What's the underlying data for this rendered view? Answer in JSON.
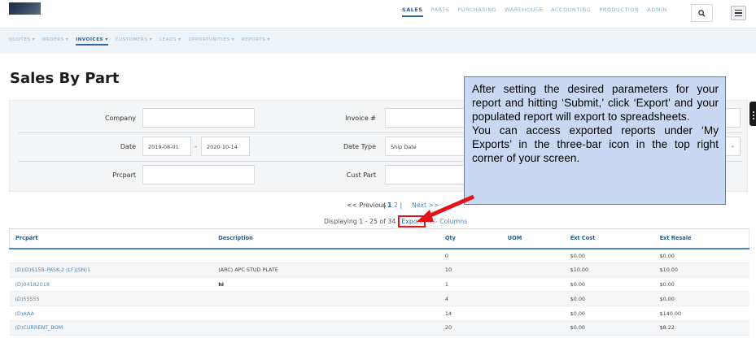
{
  "nav": {
    "main": [
      {
        "label": "SALES",
        "active": true
      },
      {
        "label": "PARTS",
        "active": false
      },
      {
        "label": "PURCHASING",
        "active": false
      },
      {
        "label": "WAREHOUSE",
        "active": false
      },
      {
        "label": "ACCOUNTING",
        "active": false
      },
      {
        "label": "PRODUCTION",
        "active": false
      },
      {
        "label": "ADMIN",
        "active": false
      }
    ],
    "sub": [
      {
        "label": "QUOTES ▾",
        "active": false
      },
      {
        "label": "ORDERS ▾",
        "active": false
      },
      {
        "label": "INVOICES ▾",
        "active": true
      },
      {
        "label": "CUSTOMERS ▾",
        "active": false
      },
      {
        "label": "LEADS ▾",
        "active": false
      },
      {
        "label": "OPPORTUNITIES ▾",
        "active": false
      },
      {
        "label": "REPORTS ▾",
        "active": false
      }
    ]
  },
  "page": {
    "title": "Sales By Part"
  },
  "filters": {
    "company_label": "Company",
    "invoice_label": "Invoice #",
    "date_label": "Date",
    "date_from": "2019-08-01",
    "date_sep": "-",
    "date_to": "2020-10-14",
    "date_type_label": "Date Type",
    "date_type_value": "Ship Date",
    "prcpart_label": "Prcpart",
    "cust_part_label": "Cust Part"
  },
  "callout": {
    "para1": "After setting the desired parameters for your report and hitting ‘Submit,’ click ‘Export’ and your populated report will export to spreadsheets.",
    "para2": "You can access exported reports under ‘My Exports’ in the three-bar icon in the top right corner of your screen."
  },
  "pagination": {
    "prev": "<< Previous",
    "sep": "|",
    "page1": "1",
    "page2": "2",
    "sep2": "|",
    "next": "Next >>",
    "displaying": "Displaying 1 - 25 of 34",
    "export": "Export",
    "columns": "+/- Columns"
  },
  "table": {
    "headers": [
      "Prcpart",
      "Description",
      "Qty",
      "UOM",
      "Ext Cost",
      "Ext Resale"
    ],
    "rows": [
      {
        "prcpart": "",
        "description": "",
        "qty": "0",
        "uom": "",
        "ext_cost": "$0.00",
        "ext_resale": "$0.00"
      },
      {
        "prcpart": "(D)(D)S15B-PASK-2 (LF)(SN)1",
        "description": "(ARC) APC STUD PLATE",
        "qty": "10",
        "uom": "",
        "ext_cost": "$10.00",
        "ext_resale": "$10.00"
      },
      {
        "prcpart": "(D)04182018",
        "description": "hi",
        "qty": "1",
        "uom": "",
        "ext_cost": "$0.00",
        "ext_resale": "$0.00"
      },
      {
        "prcpart": "(D)55555",
        "description": "",
        "qty": "4",
        "uom": "",
        "ext_cost": "$0.00",
        "ext_resale": "$0.00"
      },
      {
        "prcpart": "(D)AAA",
        "description": "",
        "qty": "14",
        "uom": "",
        "ext_cost": "$0.00",
        "ext_resale": "$140.00"
      },
      {
        "prcpart": "(D)CURRENT_BOM",
        "description": "",
        "qty": "20",
        "uom": "",
        "ext_cost": "$0.00",
        "ext_resale": "$8.22"
      }
    ]
  },
  "colors": {
    "accent": "#2a6aa3",
    "callout_bg": "#c9d9f3",
    "arrow": "#e2141a"
  }
}
